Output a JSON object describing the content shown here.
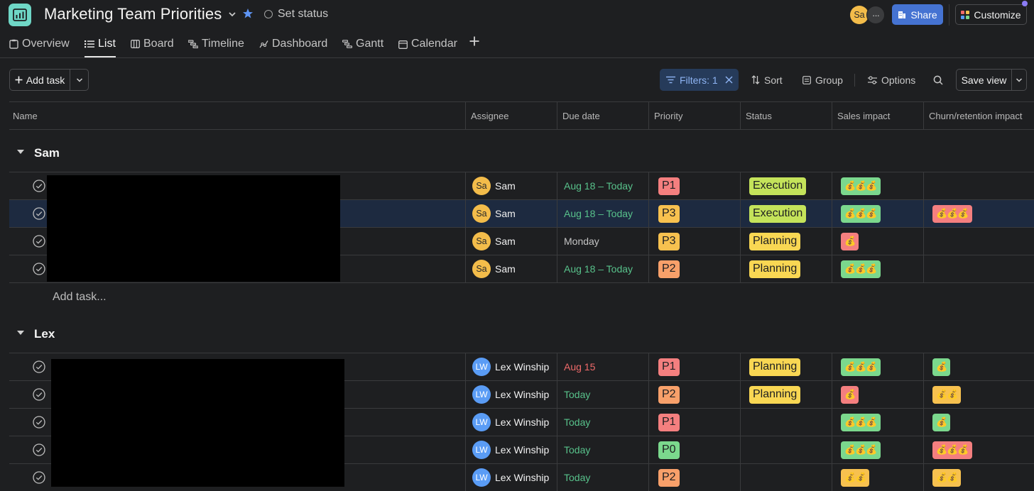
{
  "header": {
    "project_title": "Marketing Team Priorities",
    "set_status": "Set status",
    "avatar_initials": "Sa",
    "more_label": "···",
    "share_label": "Share",
    "customize_label": "Customize"
  },
  "tabs": [
    {
      "label": "Overview",
      "icon": "clipboard-icon"
    },
    {
      "label": "List",
      "icon": "list-icon",
      "active": true
    },
    {
      "label": "Board",
      "icon": "board-icon"
    },
    {
      "label": "Timeline",
      "icon": "timeline-icon"
    },
    {
      "label": "Dashboard",
      "icon": "dashboard-icon"
    },
    {
      "label": "Gantt",
      "icon": "gantt-icon"
    },
    {
      "label": "Calendar",
      "icon": "calendar-icon"
    }
  ],
  "toolbar": {
    "add_task_label": "Add task",
    "filters_label": "Filters: 1",
    "sort_label": "Sort",
    "group_label": "Group",
    "options_label": "Options",
    "save_view_label": "Save view"
  },
  "columns": [
    "Name",
    "Assignee",
    "Due date",
    "Priority",
    "Status",
    "Sales impact",
    "Churn/retention impact"
  ],
  "sections": [
    {
      "title": "Sam",
      "add_task_label": "Add task...",
      "rows": [
        {
          "initials": "Sa",
          "assignee": "Sam",
          "due": "Aug 18 – Today",
          "due_color": "green",
          "priority": "P1",
          "status": "Execution",
          "sales": "💰💰💰",
          "sales_color": "green",
          "churn": "",
          "churn_color": ""
        },
        {
          "initials": "Sa",
          "assignee": "Sam",
          "due": "Aug 18 – Today",
          "due_color": "green",
          "priority": "P3",
          "status": "Execution",
          "sales": "💰💰💰",
          "sales_color": "green",
          "churn": "💰💰💰",
          "churn_color": "red",
          "selected": true
        },
        {
          "initials": "Sa",
          "assignee": "Sam",
          "due": "Monday",
          "due_color": "grey",
          "priority": "P3",
          "status": "Planning",
          "sales": "💰",
          "sales_color": "red",
          "churn": "",
          "churn_color": ""
        },
        {
          "initials": "Sa",
          "assignee": "Sam",
          "due": "Aug 18 – Today",
          "due_color": "green",
          "priority": "P2",
          "status": "Planning",
          "sales": "💰💰💰",
          "sales_color": "green",
          "churn": "",
          "churn_color": ""
        }
      ]
    },
    {
      "title": "Lex",
      "rows": [
        {
          "initials": "LW",
          "assignee": "Lex Winship",
          "due": "Aug 15",
          "due_color": "red",
          "priority": "P1",
          "status": "Planning",
          "sales": "💰💰💰",
          "sales_color": "green",
          "churn": "💰",
          "churn_color": "green"
        },
        {
          "initials": "LW",
          "assignee": "Lex Winship",
          "due": "Today",
          "due_color": "green",
          "priority": "P2",
          "status": "Planning",
          "sales": "💰",
          "sales_color": "red",
          "churn": "💰💰",
          "churn_color": "yellow"
        },
        {
          "initials": "LW",
          "assignee": "Lex Winship",
          "due": "Today",
          "due_color": "green",
          "priority": "P1",
          "status": "",
          "sales": "💰💰💰",
          "sales_color": "green",
          "churn": "💰",
          "churn_color": "green"
        },
        {
          "initials": "LW",
          "assignee": "Lex Winship",
          "due": "Today",
          "due_color": "green",
          "priority": "P0",
          "status": "",
          "sales": "💰💰💰",
          "sales_color": "green",
          "churn": "💰💰💰",
          "churn_color": "red"
        },
        {
          "initials": "LW",
          "assignee": "Lex Winship",
          "due": "Today",
          "due_color": "green",
          "priority": "P2",
          "status": "",
          "sales": "💰💰",
          "sales_color": "yellow",
          "churn": "💰💰",
          "churn_color": "yellow"
        }
      ]
    }
  ],
  "colors": {
    "background": "#1e1f21",
    "accent_blue": "#4573d2",
    "app_icon": "#6fd7c6",
    "due_green": "#58c28b",
    "due_red": "#f06a6a"
  }
}
